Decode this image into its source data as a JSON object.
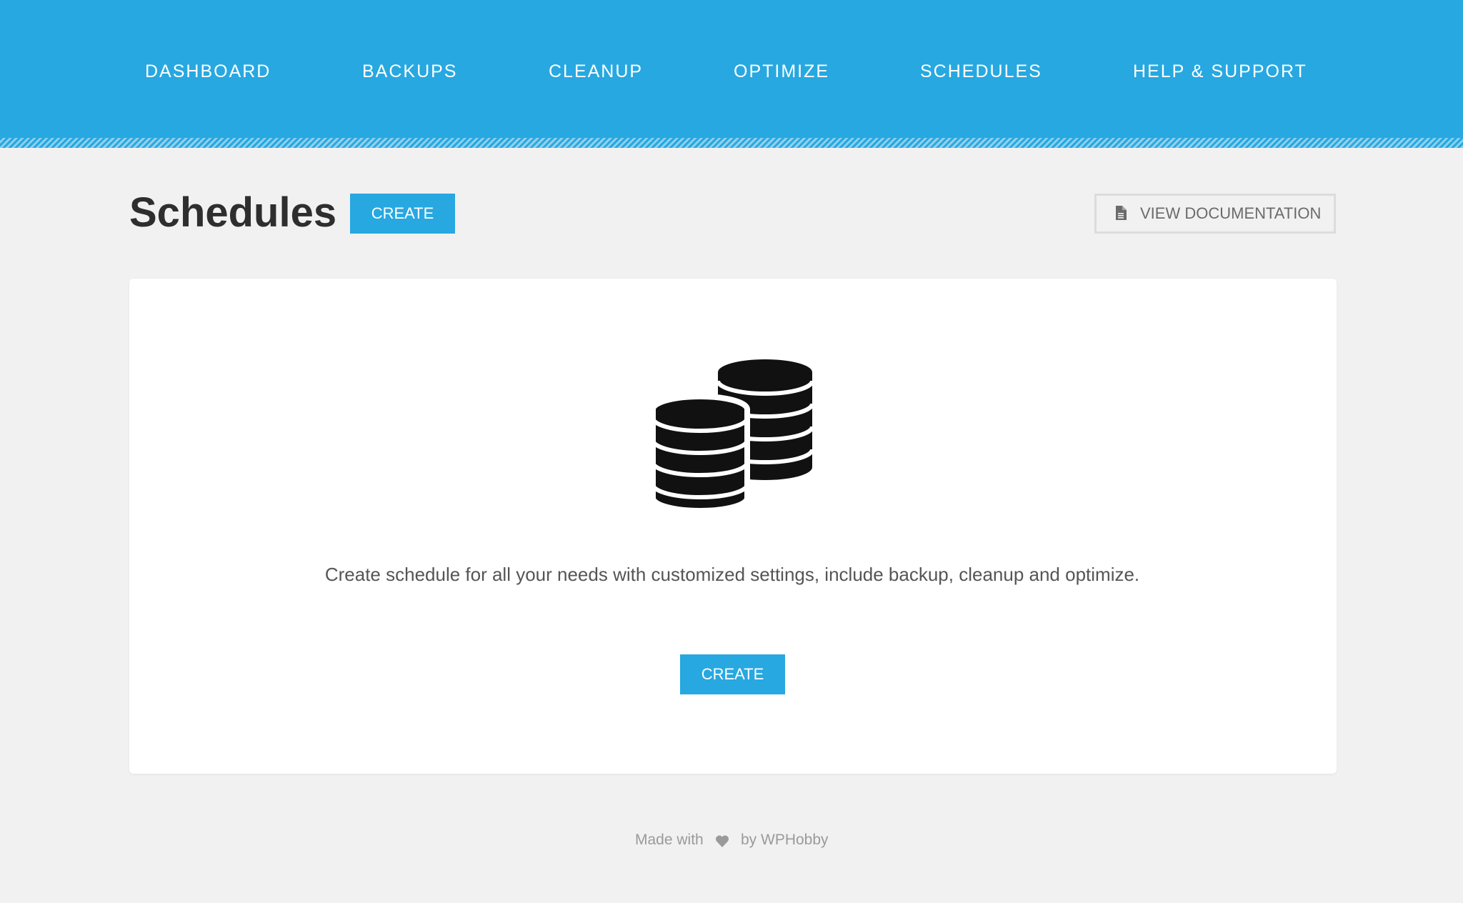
{
  "nav": {
    "items": [
      {
        "label": "DASHBOARD"
      },
      {
        "label": "BACKUPS"
      },
      {
        "label": "CLEANUP"
      },
      {
        "label": "OPTIMIZE"
      },
      {
        "label": "SCHEDULES"
      },
      {
        "label": "HELP & SUPPORT"
      }
    ]
  },
  "header": {
    "title": "Schedules",
    "create_label": "CREATE",
    "doc_label": "VIEW DOCUMENTATION",
    "doc_icon": "document-icon"
  },
  "empty_state": {
    "icon": "database-icon",
    "message": "Create schedule for all your needs with customized settings, include backup, cleanup and optimize.",
    "create_label": "CREATE"
  },
  "footer": {
    "made_with": "Made with",
    "heart_icon": "heart-icon",
    "by": "by WPHobby"
  },
  "colors": {
    "accent": "#27a8e1",
    "background": "#f1f1f1",
    "card": "#ffffff",
    "title": "#2e2e2e"
  }
}
